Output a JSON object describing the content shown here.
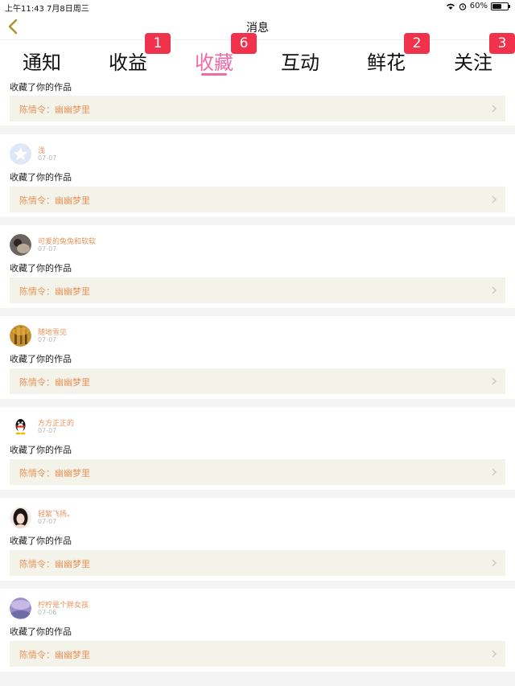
{
  "status": {
    "time_date": "上午11:43   7月8日周三",
    "battery": "60%",
    "battery_level": 0.6
  },
  "header": {
    "title": "消息"
  },
  "tabs": [
    {
      "label": "通知",
      "badge": ""
    },
    {
      "label": "收益",
      "badge": "1"
    },
    {
      "label": "收藏",
      "badge": "6",
      "active": true
    },
    {
      "label": "互动",
      "badge": ""
    },
    {
      "label": "鲜花",
      "badge": "2"
    },
    {
      "label": "关注",
      "badge": "3"
    }
  ],
  "colors": {
    "accent": "#f06aa6",
    "badge": "#f0324c",
    "name": "#e8935a"
  },
  "items": [
    {
      "user": "",
      "date": "",
      "action": "收藏了你的作品",
      "work": "陈情令：幽幽梦里",
      "avatar": ""
    },
    {
      "user": "浅",
      "date": "07-07",
      "action": "收藏了你的作品",
      "work": "陈情令：幽幽梦里",
      "avatar": "star-avatar-icon"
    },
    {
      "user": "可爱的兔兔和软软",
      "date": "07-07",
      "action": "收藏了你的作品",
      "work": "陈情令：幽幽梦里",
      "avatar": "photo-avatar"
    },
    {
      "user": "随地雪见",
      "date": "07-07",
      "action": "收藏了你的作品",
      "work": "陈情令：幽幽梦里",
      "avatar": "photo-avatar"
    },
    {
      "user": "方方正正的",
      "date": "07-07",
      "action": "收藏了你的作品",
      "work": "陈情令：幽幽梦里",
      "avatar": "penguin-avatar-icon"
    },
    {
      "user": "轻絮飞扬。",
      "date": "07-07",
      "action": "收藏了你的作品",
      "work": "陈情令：幽幽梦里",
      "avatar": "photo-avatar"
    },
    {
      "user": "柠柠是个胖女孩",
      "date": "07-06",
      "action": "收藏了你的作品",
      "work": "陈情令：幽幽梦里",
      "avatar": "photo-avatar"
    }
  ]
}
